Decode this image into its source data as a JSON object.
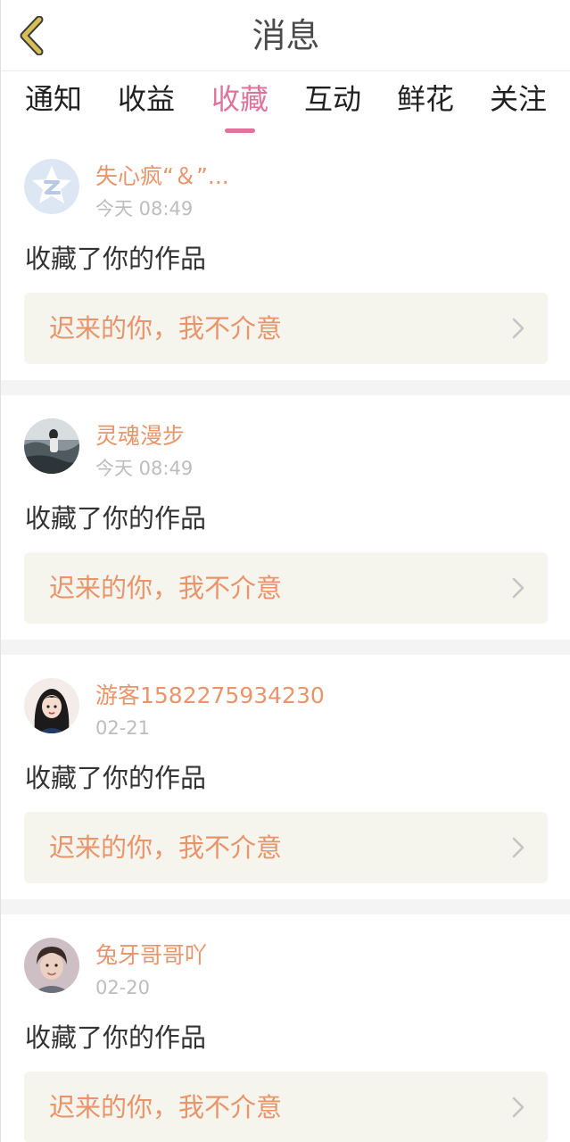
{
  "header": {
    "title": "消息"
  },
  "tabs": [
    {
      "label": "通知",
      "active": false
    },
    {
      "label": "收益",
      "active": false
    },
    {
      "label": "收藏",
      "active": true
    },
    {
      "label": "互动",
      "active": false
    },
    {
      "label": "鲜花",
      "active": false
    },
    {
      "label": "关注",
      "active": false
    }
  ],
  "colors": {
    "accent_pink": "#e0729b",
    "accent_orange": "#e8956b",
    "back_icon_yellow": "#c9b04a",
    "card_box_bg": "#f5f4ed"
  },
  "messages": [
    {
      "user": "失心疯“＆”...",
      "time": "今天 08:49",
      "action": "收藏了你的作品",
      "work_title": "迟来的你，我不介意",
      "avatar_icon": "qq-star-avatar-icon"
    },
    {
      "user": "灵魂漫步",
      "time": "今天 08:49",
      "action": "收藏了你的作品",
      "work_title": "迟来的你，我不介意",
      "avatar_icon": "photo-avatar-icon"
    },
    {
      "user": "游客1582275934230",
      "time": "02-21",
      "action": "收藏了你的作品",
      "work_title": "迟来的你，我不介意",
      "avatar_icon": "illustrated-girl-avatar-icon"
    },
    {
      "user": "兔牙哥哥吖",
      "time": "02-20",
      "action": "收藏了你的作品",
      "work_title": "迟来的你，我不介意",
      "avatar_icon": "portrait-avatar-icon"
    }
  ]
}
